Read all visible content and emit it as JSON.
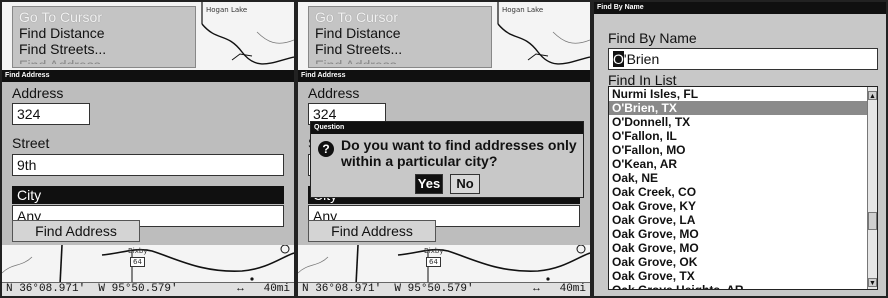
{
  "map_menu": {
    "items": [
      "Go To Cursor",
      "Find Distance",
      "Find Streets...",
      "Find Address"
    ]
  },
  "map": {
    "place_top": "Hogan Lake",
    "place_bottom": "Bixby",
    "route_shield": "64"
  },
  "status_bar": {
    "lat": "N  36°08.971'",
    "lon": "W  95°50.579'",
    "zoom_icon": "↔",
    "zoom": "40mi"
  },
  "find_address": {
    "title": "Find Address",
    "address_label": "Address",
    "address_value": "324",
    "street_label": "Street",
    "street_value": "9th",
    "city_label": "City",
    "city_value": "Any",
    "find_button": "Find Address"
  },
  "question": {
    "title": "Question",
    "icon": "question-icon",
    "message": "Do you want to find addresses only within a particular city?",
    "yes": "Yes",
    "no": "No"
  },
  "find_by_name": {
    "title": "Find By Name",
    "field_label": "Find By Name",
    "input_cursor": "O",
    "input_rest": "'Brien",
    "list_label": "Find In List",
    "selected_index": 1,
    "list": [
      "Nurmi Isles, FL",
      "O'Brien, TX",
      "O'Donnell, TX",
      "O'Fallon, IL",
      "O'Fallon, MO",
      "O'Kean, AR",
      "Oak, NE",
      "Oak Creek, CO",
      "Oak Grove, KY",
      "Oak Grove, LA",
      "Oak Grove, MO",
      "Oak Grove, MO",
      "Oak Grove, OK",
      "Oak Grove, TX",
      "Oak Grove Heights, AR"
    ]
  }
}
